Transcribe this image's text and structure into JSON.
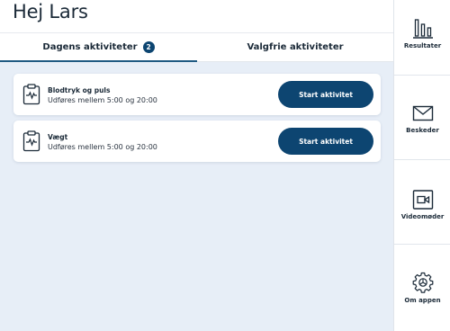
{
  "header": {
    "greeting": "Hej Lars"
  },
  "tabs": [
    {
      "label": "Dagens aktiviteter",
      "badge": "2",
      "active": true
    },
    {
      "label": "Valgfrie aktiviteter",
      "active": false
    }
  ],
  "activities": [
    {
      "title": "Blodtryk og puls",
      "subtitle": "Udføres mellem 5:00 og 20:00",
      "icon": "clipboard-pulse-icon",
      "button": "Start aktivitet"
    },
    {
      "title": "Vægt",
      "subtitle": "Udføres mellem 5:00 og 20:00",
      "icon": "clipboard-pulse-icon",
      "button": "Start aktivitet"
    }
  ],
  "sidebar": {
    "items": [
      {
        "label": "Resultater",
        "icon": "bar-chart-icon"
      },
      {
        "label": "Beskeder",
        "icon": "envelope-icon"
      },
      {
        "label": "Videomøder",
        "icon": "video-camera-icon"
      },
      {
        "label": "Om appen",
        "icon": "gear-icon"
      }
    ]
  },
  "colors": {
    "primary": "#0d4571",
    "background": "#e7eef7",
    "text": "#1b2a38"
  }
}
